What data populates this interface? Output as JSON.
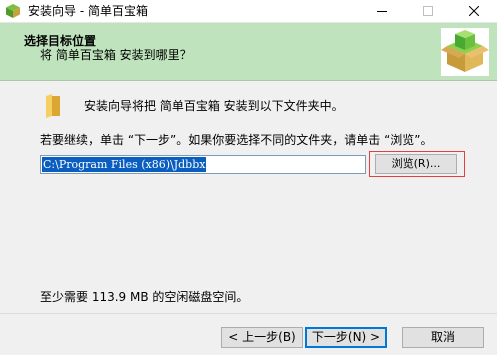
{
  "window": {
    "title": "安装向导 - 简单百宝箱"
  },
  "header": {
    "title": "选择目标位置",
    "subtitle": "将 简单百宝箱 安装到哪里？"
  },
  "content": {
    "install_desc": "安装向导将把 简单百宝箱 安装到以下文件夹中。",
    "instruction": "若要继续，单击 “下一步”。如果你要选择不同的文件夹，请单击 “浏览”。",
    "path_value": "C:\\Program Files (x86)\\Jdbbx",
    "browse_label": "浏览(R)...",
    "space_required": "至少需要 113.9 MB 的空闲磁盘空间。"
  },
  "footer": {
    "back_label": "< 上一步(B)",
    "next_label": "下一步(N) >",
    "cancel_label": "取消"
  },
  "icons": {
    "app": "green-box-icon",
    "folder": "folder-icon",
    "logo": "install-box-logo",
    "minimize": "minimize-icon",
    "maximize": "maximize-icon",
    "close": "close-icon"
  },
  "colors": {
    "header_bg": "#bfe3bc",
    "selection": "#0a5ebf",
    "highlight_border": "#e04040",
    "default_button_border": "#0078d7"
  }
}
